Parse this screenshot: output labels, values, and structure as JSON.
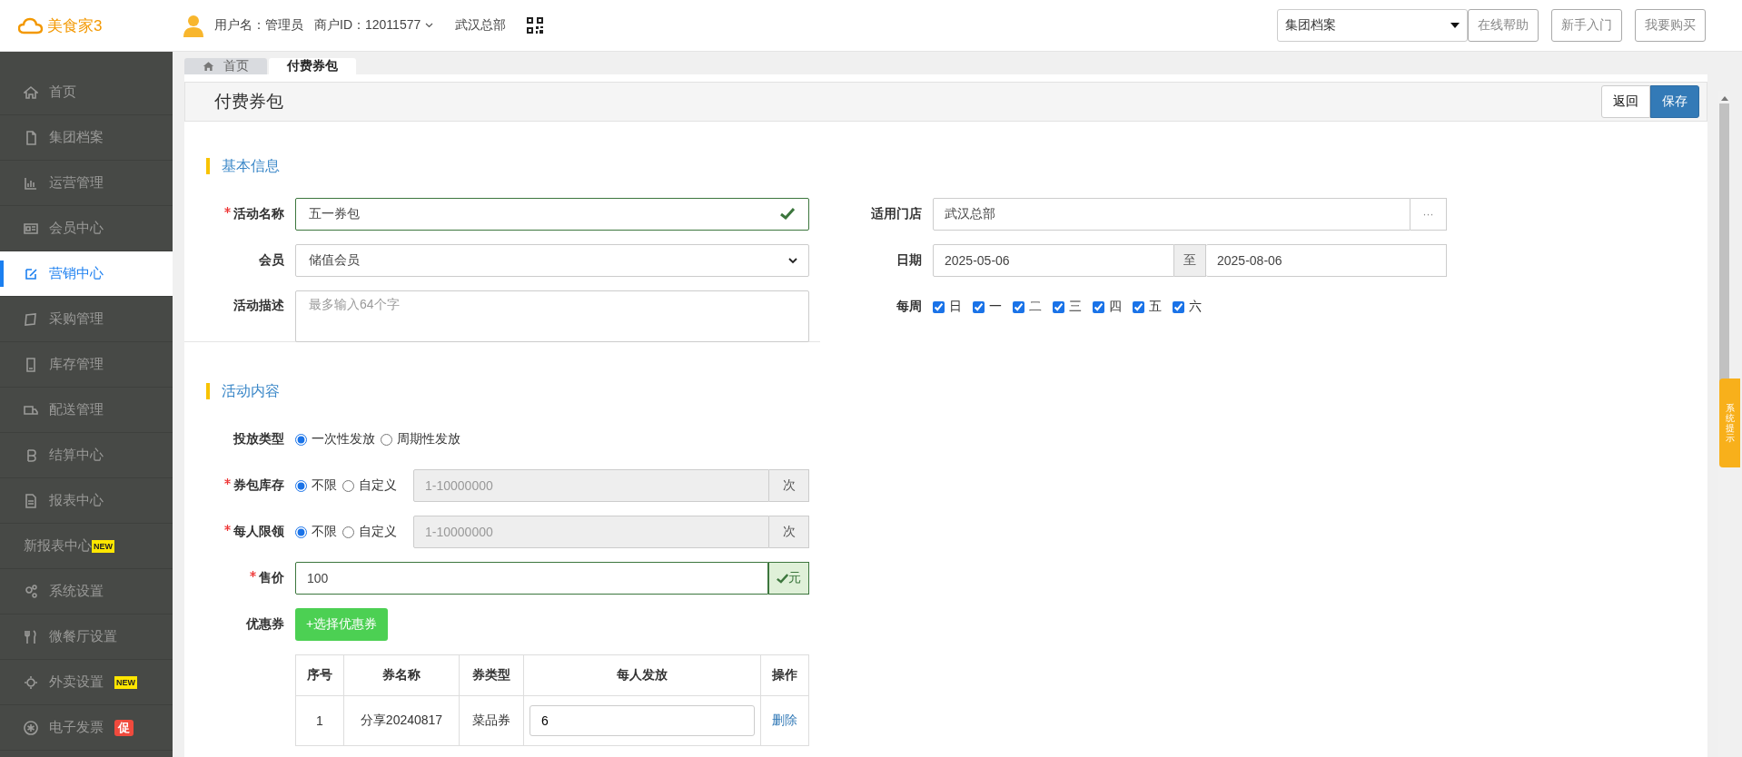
{
  "header": {
    "logo": "美食家3",
    "user": "用户名：管理员",
    "merchant": "商户ID：12011577",
    "store": "武汉总部",
    "archive_select": "集团档案",
    "links": [
      "在线帮助",
      "新手入门",
      "我要购买"
    ]
  },
  "sidebar": {
    "items": [
      {
        "label": "首页",
        "selected": false
      },
      {
        "label": "集团档案",
        "selected": false
      },
      {
        "label": "运营管理",
        "selected": false
      },
      {
        "label": "会员中心",
        "selected": false
      },
      {
        "label": "营销中心",
        "selected": true
      },
      {
        "label": "采购管理",
        "selected": false
      },
      {
        "label": "库存管理",
        "selected": false
      },
      {
        "label": "配送管理",
        "selected": false
      },
      {
        "label": "结算中心",
        "selected": false
      },
      {
        "label": "报表中心",
        "selected": false
      },
      {
        "label": "新报表中心",
        "selected": false,
        "badge": {
          "text": "NEW",
          "kind": "new"
        }
      },
      {
        "label": "系统设置",
        "selected": false
      },
      {
        "label": "微餐厅设置",
        "selected": false
      },
      {
        "label": "外卖设置",
        "selected": false,
        "badge": {
          "text": "NEW",
          "kind": "new"
        }
      },
      {
        "label": "电子发票",
        "selected": false,
        "badge": {
          "text": "促",
          "kind": "promo"
        }
      }
    ]
  },
  "tabs": [
    {
      "label": "首页",
      "selected": false
    },
    {
      "label": "付费券包",
      "selected": true
    }
  ],
  "page": {
    "title": "付费券包",
    "actions": [
      {
        "label": "返回",
        "kind": "default"
      },
      {
        "label": "保存",
        "kind": "primary"
      }
    ]
  },
  "basic_info": {
    "heading": "基本信息",
    "name": {
      "label": "活动名称",
      "required": true,
      "value": "五一券包",
      "valid": true
    },
    "member": {
      "label": "会员",
      "value": "储值会员"
    },
    "description": {
      "label": "活动描述",
      "placeholder": "最多输入64个字"
    },
    "store": {
      "label": "适用门店",
      "value": "武汉总部",
      "button": "···"
    },
    "date": {
      "label": "日期",
      "start": "2025-05-06",
      "separator": "至",
      "end": "2025-08-06"
    },
    "weekly": {
      "label": "每周",
      "days": [
        {
          "label": "日",
          "checked": true
        },
        {
          "label": "一",
          "checked": true
        },
        {
          "label": "二",
          "checked": true
        },
        {
          "label": "三",
          "checked": true
        },
        {
          "label": "四",
          "checked": true
        },
        {
          "label": "五",
          "checked": true
        },
        {
          "label": "六",
          "checked": true
        }
      ]
    }
  },
  "content": {
    "heading": "活动内容",
    "delivery": {
      "label": "投放类型",
      "options": [
        {
          "label": "一次性发放",
          "selected": true
        },
        {
          "label": "周期性发放",
          "selected": false
        }
      ]
    },
    "stock": {
      "label": "券包库存",
      "required": true,
      "options": [
        {
          "label": "不限",
          "selected": true
        },
        {
          "label": "自定义",
          "selected": false
        }
      ],
      "placeholder": "1-10000000",
      "disabled": true,
      "unit": "次"
    },
    "limit": {
      "label": "每人限领",
      "required": true,
      "options": [
        {
          "label": "不限",
          "selected": true
        },
        {
          "label": "自定义",
          "selected": false
        }
      ],
      "placeholder": "1-10000000",
      "disabled": true,
      "unit": "次"
    },
    "price": {
      "label": "售价",
      "required": true,
      "value": "100",
      "valid": true,
      "unit": "元"
    },
    "coupons": {
      "label": "优惠券",
      "button": "+选择优惠券",
      "table": {
        "columns": [
          "序号",
          "券名称",
          "券类型",
          "每人发放",
          "操作"
        ],
        "rows": [
          {
            "index": "1",
            "name": "分享20240817",
            "type": "菜品券",
            "per_person": "6",
            "action": "删除"
          }
        ]
      }
    }
  },
  "side_tab": {
    "label": "系统提示"
  }
}
